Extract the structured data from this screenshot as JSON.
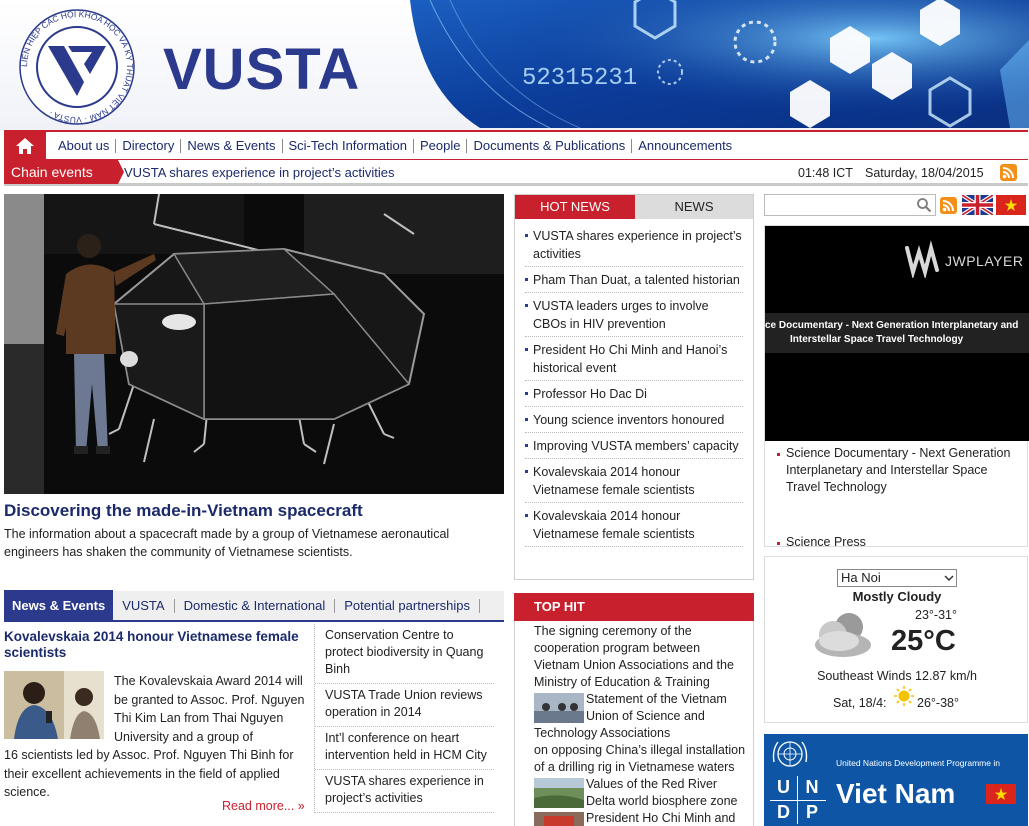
{
  "site": {
    "brand": "VUSTA",
    "logo_text": "LIÊN HIỆP CÁC HỘI KHOA HỌC VÀ KỸ THUẬT VIỆT NAM · VUSTA ·",
    "banner_number": "52315231"
  },
  "nav": {
    "home_icon": "home-icon",
    "items": [
      "About us",
      "Directory",
      "News & Events",
      "Sci-Tech Information",
      "People",
      "Documents & Publications",
      "Announcements"
    ]
  },
  "chain": {
    "label": "Chain events",
    "headline": "VUSTA shares experience in project’s activities",
    "time": "01:48 ICT",
    "date": "Saturday, 18/04/2015"
  },
  "feature": {
    "title": "Discovering the made-in-Vietnam spacecraft",
    "description": "The information about a spacecraft made by a group of Vietnamese aeronautical engineers has shaken the community of Vietnamese scientists."
  },
  "hot_news": {
    "tab_active": "HOT NEWS",
    "tab_other": "NEWS",
    "items": [
      "VUSTA shares experience in project’s activities",
      "Pham Than Duat, a talented historian",
      "VUSTA leaders urges to involve CBOs in HIV prevention",
      "President Ho Chi Minh and Hanoi’s historical event",
      "Professor Ho Dac Di",
      "Young science inventors honoured",
      "Improving VUSTA members’ capacity",
      "Kovalevskaia 2014 honour Vietnamese female scientists",
      "Kovalevskaia 2014 honour Vietnamese female scientists"
    ]
  },
  "news_tabs": {
    "active": "News & Events",
    "tabs": [
      "VUSTA",
      "Domestic & International",
      "Potential partnerships"
    ]
  },
  "top_story": {
    "title": "Kovalevskaia 2014 honour Vietnamese female scientists",
    "body_indented": "The Kovalevskaia Award 2014 will be granted to Assoc. Prof. Nguyen Thi Kim Lan from Thai Nguyen University and a group of",
    "body_rest": "16 scientists led by Assoc. Prof. Nguyen Thi Binh for their excellent achievements in the field of applied science.",
    "read_more": "Read more..."
  },
  "side_news": [
    "Conservation Centre to protect biodiversity in Quang Binh",
    "VUSTA Trade Union reviews operation in 2014",
    "Int’l conference on heart intervention held in HCM City",
    "VUSTA shares experience in project’s activities"
  ],
  "top_hit": {
    "header": "TOP HIT",
    "intro": "The signing ceremony of the cooperation program between Vietnam Union Associations and the Ministry of Education & Training",
    "item2_wrap": "Statement of the Vietnam Union of Science and Technology Associations",
    "item2_rest": "on opposing China’s illegal installation of a drilling rig in Vietnamese waters",
    "item3": "Values of the Red River Delta world biosphere zone",
    "item4": "President Ho Chi Minh and"
  },
  "video": {
    "player_name": "JWPLAYER",
    "overlay_line1": "ce Documentary - Next Generation Interplanetary and",
    "overlay_line2": "Interstellar Space Travel Technology",
    "items": [
      "Science Documentary - Next Generation Interplanetary and Interstellar Space Travel Technology",
      "Science Press"
    ]
  },
  "weather": {
    "city": "Ha Noi",
    "condition": "Mostly Cloudy",
    "range": "23°-31°",
    "temperature": "25°C",
    "wind": "Southeast Winds 12.87 km/h",
    "forecast_day": "Sat, 18/4:",
    "forecast_range": "26°-38°"
  },
  "undp": {
    "org": "United Nations Development Programme in",
    "letters": [
      "U",
      "N",
      "D",
      "P"
    ],
    "country": "Viet Nam"
  },
  "colors": {
    "brand_blue": "#2b3a8c",
    "accent_red": "#c8202c"
  }
}
